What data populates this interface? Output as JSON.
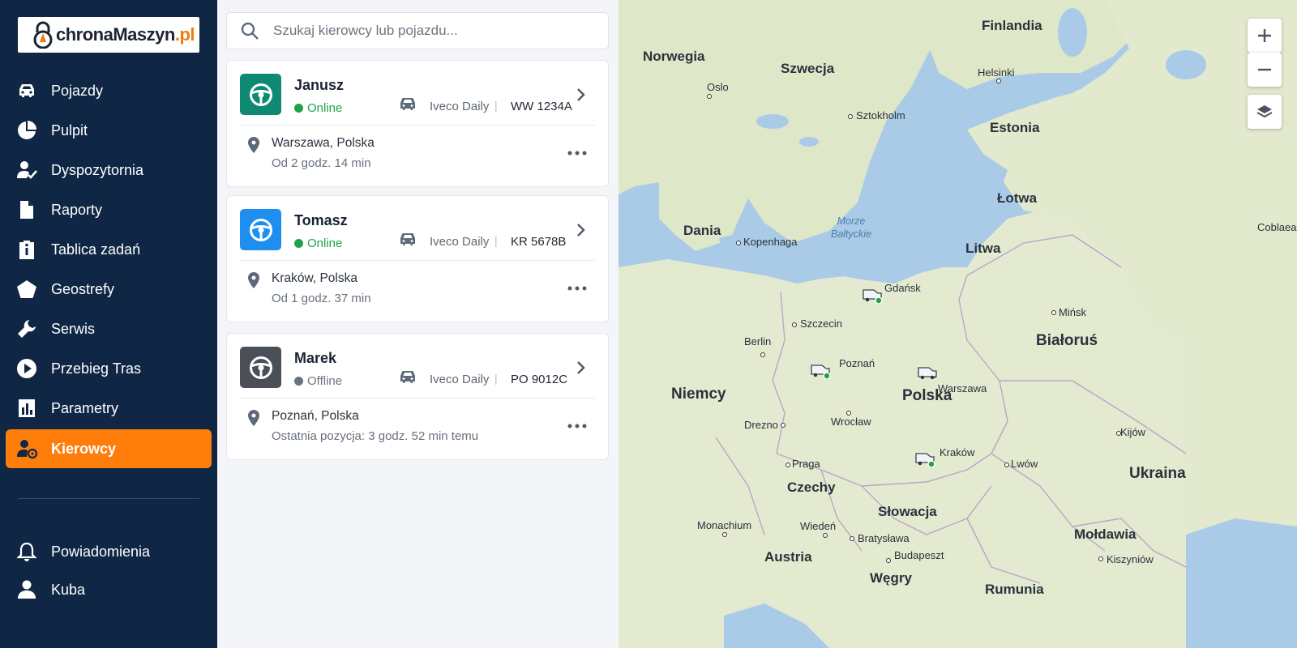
{
  "brand": {
    "name_main": "chronaMaszyn",
    "name_suffix": ".pl"
  },
  "sidebar": {
    "items": [
      {
        "label": "Pojazdy",
        "icon": "car-icon"
      },
      {
        "label": "Pulpit",
        "icon": "pie-chart-icon"
      },
      {
        "label": "Dyspozytornia",
        "icon": "user-check-icon"
      },
      {
        "label": "Raporty",
        "icon": "document-icon"
      },
      {
        "label": "Tablica zadań",
        "icon": "clipboard-icon"
      },
      {
        "label": "Geostrefy",
        "icon": "pentagon-icon"
      },
      {
        "label": "Serwis",
        "icon": "wrench-icon"
      },
      {
        "label": "Przebieg Tras",
        "icon": "play-circle-icon"
      },
      {
        "label": "Parametry",
        "icon": "bar-chart-icon"
      },
      {
        "label": "Kierowcy",
        "icon": "driver-icon",
        "active": true
      }
    ],
    "bottom": [
      {
        "label": "Powiadomienia",
        "icon": "bell-icon"
      },
      {
        "label": "Kuba",
        "icon": "user-icon"
      }
    ]
  },
  "search": {
    "placeholder": "Szukaj kierowcy lub pojazdu..."
  },
  "drivers": [
    {
      "name": "Janusz",
      "status": "Online",
      "status_color": "#1fa34a",
      "avatar_color": "#0e8a73",
      "vehicle": "Iveco Daily",
      "plate": "WW 1234A",
      "location": "Warszawa, Polska",
      "since": "Od 2 godz. 14 min"
    },
    {
      "name": "Tomasz",
      "status": "Online",
      "status_color": "#1fa34a",
      "avatar_color": "#1f8ef1",
      "vehicle": "Iveco Daily",
      "plate": "KR 5678B",
      "location": "Kraków, Polska",
      "since": "Od 1 godz. 37 min"
    },
    {
      "name": "Marek",
      "status": "Offline",
      "status_color": "#6b7380",
      "avatar_color": "#4a4f58",
      "vehicle": "Iveco Daily",
      "plate": "PO 9012C",
      "location": "Poznań, Polska",
      "since": "Ostatnia pozycja: 3 godz. 52 min temu"
    }
  ],
  "map": {
    "countries": [
      "Finlandia",
      "Norwegia",
      "Szwecja",
      "Estonia",
      "Łotwa",
      "Dania",
      "Litwa",
      "Białoruś",
      "Niemcy",
      "Polska",
      "Czechy",
      "Słowacja",
      "Ukraina",
      "Austria",
      "Mołdawia",
      "Węgry",
      "Rumunia"
    ],
    "cities": [
      "Oslo",
      "Helsinki",
      "Sztokholm",
      "Kopenhaga",
      "Gdańsk",
      "Szczecin",
      "Berlin",
      "Poznań",
      "Warszawa",
      "Mińsk",
      "Wrocław",
      "Drezno",
      "Kijów",
      "Kraków",
      "Praga",
      "Lwów",
      "Monachium",
      "Wiedeń",
      "Bratysława",
      "Budapeszt",
      "Kiszyniów"
    ],
    "sea": "Morze Bałtyckie",
    "edge_label": "Coblaea"
  }
}
